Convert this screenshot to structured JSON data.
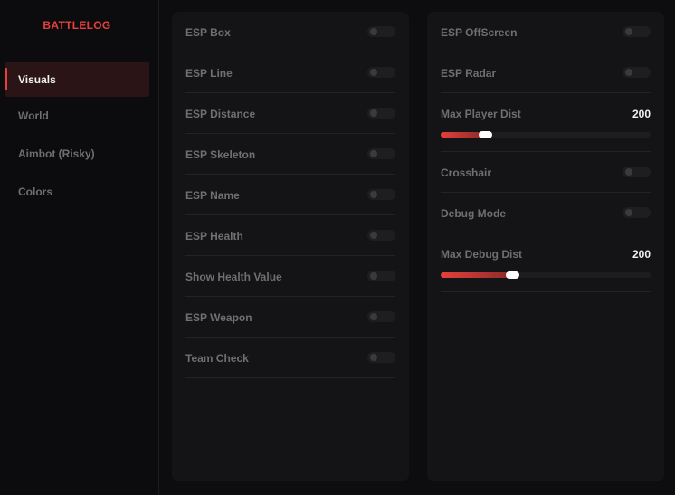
{
  "brand": "BATTLELOG",
  "nav": [
    {
      "label": "Visuals",
      "active": true
    },
    {
      "label": "World",
      "active": false
    },
    {
      "label": "Aimbot (Risky)",
      "active": false
    },
    {
      "label": "Colors",
      "active": false
    }
  ],
  "left_panel": {
    "rows": [
      {
        "label": "ESP Box",
        "enabled": false
      },
      {
        "label": "ESP Line",
        "enabled": false
      },
      {
        "label": "ESP Distance",
        "enabled": false
      },
      {
        "label": "ESP Skeleton",
        "enabled": false
      },
      {
        "label": "ESP Name",
        "enabled": false
      },
      {
        "label": "ESP Health",
        "enabled": false
      },
      {
        "label": "Show Health Value",
        "enabled": false
      },
      {
        "label": "ESP Weapon",
        "enabled": false
      },
      {
        "label": "Team Check",
        "enabled": false
      }
    ]
  },
  "right_panel": {
    "rows": [
      {
        "label": "ESP OffScreen",
        "enabled": false
      },
      {
        "label": "ESP Radar",
        "enabled": false
      },
      {
        "label": "Max Player Dist",
        "value": "200",
        "fill_fraction": 0.21
      },
      {
        "label": "Crosshair",
        "enabled": false
      },
      {
        "label": "Debug Mode",
        "enabled": false
      },
      {
        "label": "Max Debug Dist",
        "value": "200",
        "fill_fraction": 0.34
      }
    ]
  },
  "colors": {
    "accent": "#e5403c",
    "panel_bg": "#141416",
    "active_nav_bg": "#2a1416"
  }
}
